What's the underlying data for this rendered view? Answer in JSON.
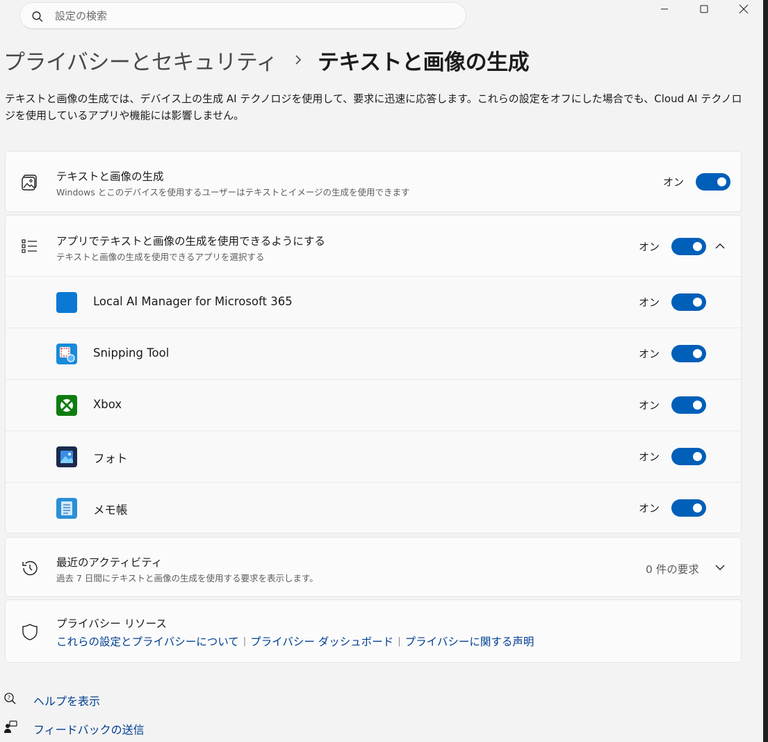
{
  "search": {
    "placeholder": "設定の検索"
  },
  "breadcrumb": {
    "parent": "プライバシーとセキュリティ",
    "current": "テキストと画像の生成"
  },
  "description": "テキストと画像の生成では、デバイス上の生成 AI テクノロジを使用して、要求に迅速に応答します。これらの設定をオフにした場合でも、Cloud AI テクノロジを使用しているアプリや機能には影響しません。",
  "main_setting": {
    "label": "テキストと画像の生成",
    "sub": "Windows とこのデバイスを使用するユーザーはテキストとイメージの生成を使用できます",
    "state": "オン"
  },
  "apps_setting": {
    "label": "アプリでテキストと画像の生成を使用できるようにする",
    "sub": "テキストと画像の生成を使用できるアプリを選択する",
    "state": "オン",
    "apps": [
      {
        "name": "Local AI Manager for Microsoft 365",
        "state": "オン",
        "icon": "local-ai-manager-icon"
      },
      {
        "name": "Snipping Tool",
        "state": "オン",
        "icon": "snipping-tool-icon"
      },
      {
        "name": "Xbox",
        "state": "オン",
        "icon": "xbox-icon"
      },
      {
        "name": "フォト",
        "state": "オン",
        "icon": "photos-icon"
      },
      {
        "name": "メモ帳",
        "state": "オン",
        "icon": "notepad-icon"
      }
    ]
  },
  "activity": {
    "label": "最近のアクティビティ",
    "sub": "過去 7 日間にテキストと画像の生成を使用する要求を表示します。",
    "value": "0 件の要求"
  },
  "privacy": {
    "label": "プライバシー リソース",
    "links": [
      "これらの設定とプライバシーについて",
      "プライバシー ダッシュボード",
      "プライバシーに関する声明"
    ]
  },
  "footer": {
    "help": "ヘルプを表示",
    "feedback": "フィードバックの送信"
  },
  "colors": {
    "accent": "#005fb8",
    "link": "#003e92",
    "background": "#f3f3f3",
    "card": "#fbfbfb"
  }
}
